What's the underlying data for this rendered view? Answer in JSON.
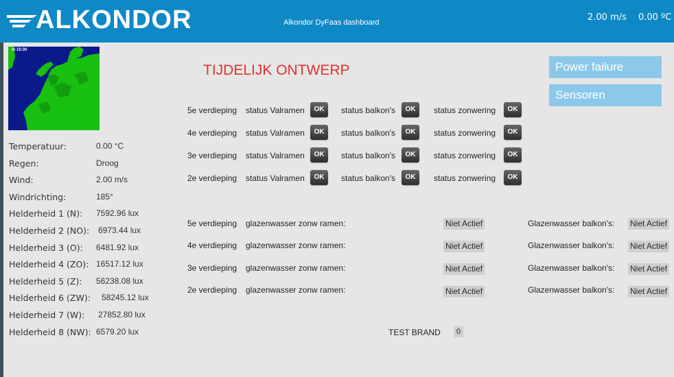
{
  "header": {
    "logo_text": "ALKONDOR",
    "title": "Alkondor DyFaas dashboard",
    "wind": "2.00 m/s",
    "temperature": "0.00 ºC",
    "colors": {
      "bar": "#0f88c6",
      "text": "#ffffff"
    }
  },
  "map": {
    "time_label": "di 15:30",
    "icon": "weather-radar-map"
  },
  "weather": [
    {
      "label": "Temperatuur:",
      "value": "0.00 °C"
    },
    {
      "label": "Regen:",
      "value": "Droog"
    },
    {
      "label": "Wind:",
      "value": "2.00 m/s"
    },
    {
      "label": "Windrichting:",
      "value": "185°"
    },
    {
      "label": "Helderheid 1 (N):",
      "value": "7592.96 lux"
    },
    {
      "label": "Helderheid 2 (NO):",
      "value": "6973.44 lux"
    },
    {
      "label": "Helderheid 3 (O):",
      "value": "6481.92 lux"
    },
    {
      "label": "Helderheid 4 (ZO):",
      "value": "16517.12 lux"
    },
    {
      "label": "Helderheid 5 (Z):",
      "value": "56238.08 lux"
    },
    {
      "label": "Helderheid 6 (ZW):",
      "value": "58245.12 lux"
    },
    {
      "label": "Helderheid 7 (W):",
      "value": "27852.80 lux"
    },
    {
      "label": "Helderheid 8 (NW):",
      "value": "6579.20 lux"
    }
  ],
  "draft_label": "TIJDELIJK ONTWERP",
  "side_buttons": {
    "power_failure": "Power failure",
    "sensoren": "Sensoren",
    "color": "#8cc8ea"
  },
  "status_rows": [
    {
      "floor": "5e verdieping",
      "valramen_label": "status Valramen",
      "valramen": "OK",
      "balkon_label": "status balkon's",
      "balkon": "OK",
      "zonwering_label": "status zonwering",
      "zonwering": "OK"
    },
    {
      "floor": "4e verdieping",
      "valramen_label": "status Valramen",
      "valramen": "OK",
      "balkon_label": "status balkon's",
      "balkon": "OK",
      "zonwering_label": "status zonwering",
      "zonwering": "OK"
    },
    {
      "floor": "3e verdieping",
      "valramen_label": "status Valramen",
      "valramen": "OK",
      "balkon_label": "status balkon's",
      "balkon": "OK",
      "zonwering_label": "status zonwering",
      "zonwering": "OK"
    },
    {
      "floor": "2e verdieping",
      "valramen_label": "status Valramen",
      "valramen": "OK",
      "balkon_label": "status balkon's",
      "balkon": "OK",
      "zonwering_label": "status zonwering",
      "zonwering": "OK"
    }
  ],
  "washer_rows": [
    {
      "floor": "5e verdieping",
      "label": "glazenwasser zonw ramen:",
      "value": "Niet Actief",
      "balkon_label": "Glazenwasser balkon's:",
      "balkon_value": "Niet Actief"
    },
    {
      "floor": "4e verdieping",
      "label": "glazenwasser zonw ramen:",
      "value": "Niet Actief",
      "balkon_label": "Glazenwasser balkon's:",
      "balkon_value": "Niet Actief"
    },
    {
      "floor": "3e verdieping",
      "label": "glazenwasser zonw ramen:",
      "value": "Niet Actief",
      "balkon_label": "Glazenwasser balkon's:",
      "balkon_value": "Niet Actief"
    },
    {
      "floor": "2e verdieping",
      "label": "glazenwasser zonw ramen:",
      "value": "Niet Actief",
      "balkon_label": "Glazenwasser balkon's:",
      "balkon_value": "Niet Actief"
    }
  ],
  "test_brand": {
    "label": "TEST BRAND",
    "value": "0"
  },
  "colors": {
    "accent_red": "#e4322a",
    "ok_button": "#3a3a3a",
    "background": "#e6e6e6"
  }
}
